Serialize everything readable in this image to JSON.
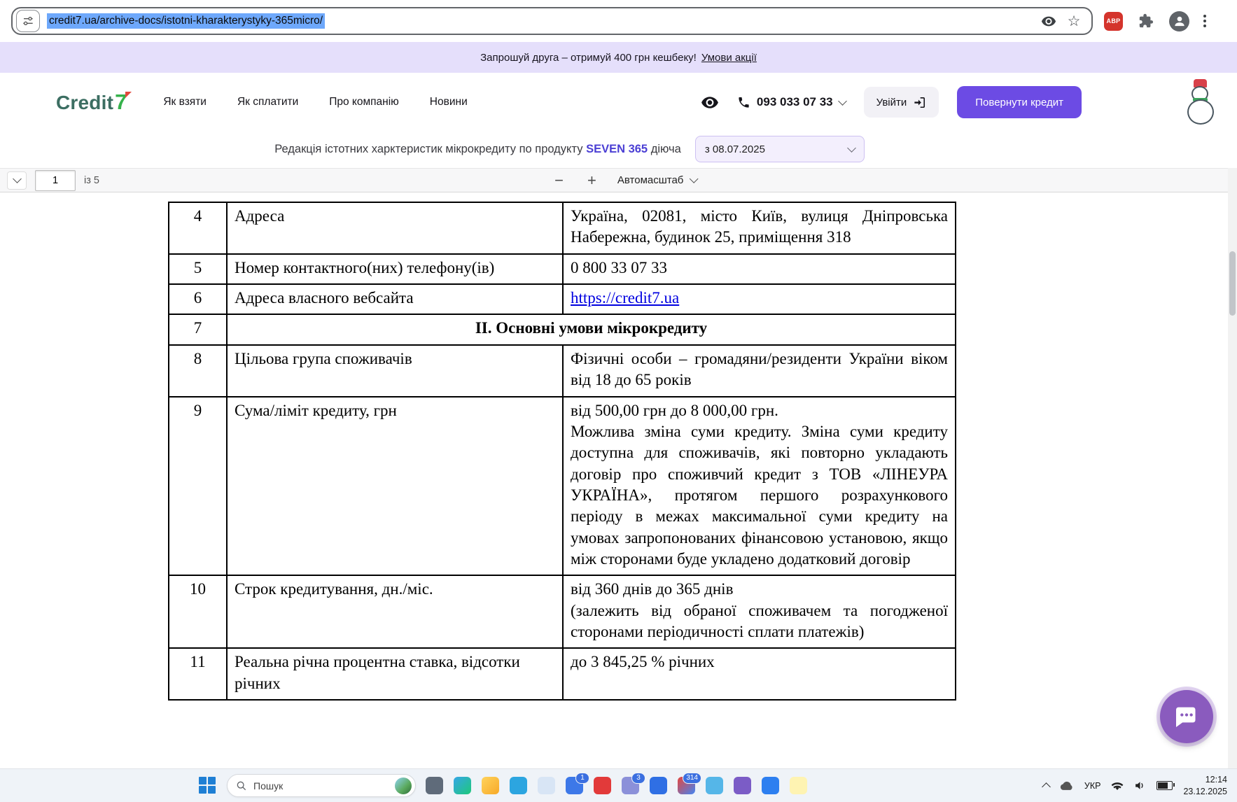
{
  "browser": {
    "url": "credit7.ua/archive-docs/istotni-kharakterystyky-365micro/",
    "adblock_label": "ABP"
  },
  "promo": {
    "text": "Запрошуй друга – отримуй 400 грн кешбеку!",
    "link_label": "Умови акції"
  },
  "site_header": {
    "logo_word": "Credit",
    "logo_digit": "7",
    "nav": {
      "item1": "Як взяти",
      "item2": "Як сплатити",
      "item3": "Про компанію",
      "item4": "Новини"
    },
    "phone_number": "093 033 07 33",
    "login_label": "Увійти",
    "cta_label": "Повернути кредит"
  },
  "subheader": {
    "text_before": "Редакція істотних харктеристик мікрокредиту по продукту",
    "product_name": "SEVEN 365",
    "text_after": "діюча",
    "date_dropdown_value": "з 08.07.2025"
  },
  "pdf_toolbar": {
    "page_number": "1",
    "page_count_label": "із 5",
    "zoom_mode_label": "Автомасштаб"
  },
  "document": {
    "rows": [
      {
        "num": "4",
        "label": "Адреса",
        "value": "Україна, 02081, місто Київ, вулиця Дніпровська Набережна, будинок 25, приміщення 318"
      },
      {
        "num": "5",
        "label": "Номер контактного(них) телефону(ів)",
        "value": "0 800 33 07 33"
      },
      {
        "num": "6",
        "label": "Адреса власного вебсайта",
        "value": "https://credit7.ua"
      },
      {
        "num": "7",
        "section_title": "ІІ. Основні умови мікрокредиту"
      },
      {
        "num": "8",
        "label": "Цільова група споживачів",
        "value": "Фізичні особи – громадяни/резиденти України віком від 18 до 65 років"
      },
      {
        "num": "9",
        "label": "Сума/ліміт кредиту, грн",
        "value": "від 500,00 грн до 8 000,00 грн.\nМожлива зміна суми кредиту. Зміна суми кредиту доступна для споживачів, які повторно укладають договір про споживчий кредит з ТОВ «ЛІНЕУРА УКРАЇНА», протягом першого розрахункового періоду в межах максимальної суми кредиту на умовах запропонованих фінансовою установою, якщо між сторонами буде укладено додатковий договір"
      },
      {
        "num": "10",
        "label": "Строк кредитування, дн./міс.",
        "value": "від 360 днів до 365 днів\n(залежить від обраної споживачем та погодженої сторонами періодичності сплати платежів)"
      },
      {
        "num": "11",
        "label": "Реальна річна процентна ставка, відсотки річних",
        "value": "до 3 845,25 % річних"
      }
    ]
  },
  "taskbar": {
    "search_label": "Пошук",
    "apps": [
      {
        "icon": "widgets-icon",
        "color": "#5f6b7a"
      },
      {
        "icon": "edge-icon",
        "color": "#35a6e8",
        "color2": "#1ec87a"
      },
      {
        "icon": "file-explorer-icon",
        "color": "#ffd35c",
        "color2": "#f7a928"
      },
      {
        "icon": "telegram-icon",
        "color": "#2ca5e0"
      },
      {
        "icon": "store-icon",
        "color": "#d8e5f5"
      },
      {
        "icon": "mail-icon",
        "color": "#3d78e8",
        "badge": "1"
      },
      {
        "icon": "opera-icon",
        "color": "#e23a3a"
      },
      {
        "icon": "contacts-icon",
        "color": "#8b90d9",
        "badge": "3"
      },
      {
        "icon": "dropbox-icon",
        "color": "#2f6fe4"
      },
      {
        "icon": "chrome-icon",
        "color": "#e8453c",
        "color2": "#4285f4",
        "badge": "314"
      },
      {
        "icon": "skype-icon",
        "color": "#55b6e8"
      },
      {
        "icon": "viber-icon",
        "color": "#7b5cc6"
      },
      {
        "icon": "messenger-icon",
        "color": "#2d7ff0"
      },
      {
        "icon": "notes-icon",
        "color": "#fef3b2"
      }
    ],
    "language_indicator": "УКР",
    "time": "12:14",
    "date": "23.12.2025"
  },
  "colors": {
    "accent_purple": "#6c4be4",
    "promo_bg": "#e5dffb",
    "url_selection_blue": "#6ea8fb",
    "doc_link_blue": "#0000e0"
  }
}
